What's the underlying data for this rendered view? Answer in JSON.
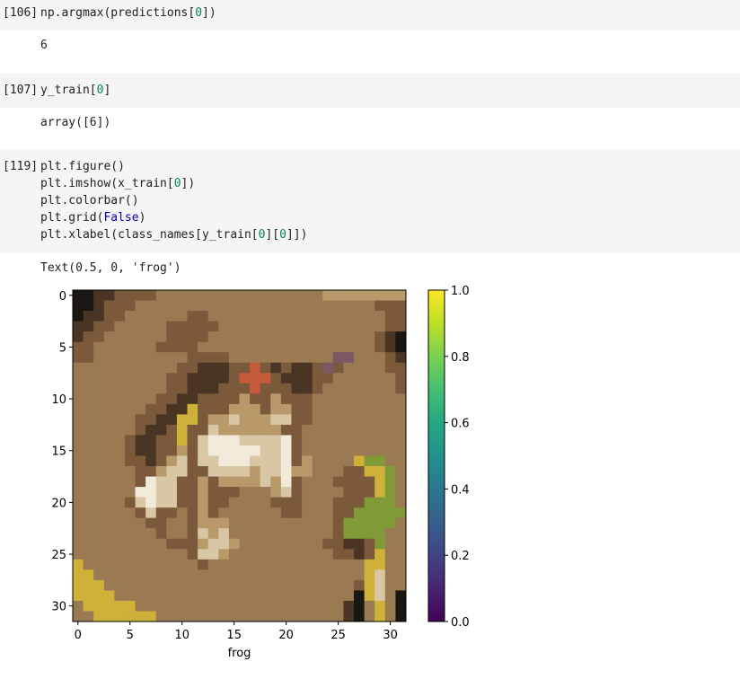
{
  "cells": [
    {
      "prompt": "[106]",
      "code": [
        {
          "parts": [
            {
              "t": "np.argmax(predictions["
            },
            {
              "t": "0",
              "c": "num"
            },
            {
              "t": "])"
            }
          ]
        }
      ],
      "output": "6"
    },
    {
      "prompt": "[107]",
      "code": [
        {
          "parts": [
            {
              "t": "y_train["
            },
            {
              "t": "0",
              "c": "num"
            },
            {
              "t": "]"
            }
          ]
        }
      ],
      "output": "array([6])"
    },
    {
      "prompt": "[119]",
      "code": [
        {
          "parts": [
            {
              "t": "plt.figure()"
            }
          ]
        },
        {
          "parts": [
            {
              "t": "plt.imshow(x_train["
            },
            {
              "t": "0",
              "c": "num"
            },
            {
              "t": "])"
            }
          ]
        },
        {
          "parts": [
            {
              "t": "plt.colorbar()"
            }
          ]
        },
        {
          "parts": [
            {
              "t": "plt.grid("
            },
            {
              "t": "False",
              "c": "kw"
            },
            {
              "t": ")"
            }
          ]
        },
        {
          "parts": [
            {
              "t": "plt.xlabel(class_names[y_train["
            },
            {
              "t": "0",
              "c": "num"
            },
            {
              "t": "]["
            },
            {
              "t": "0",
              "c": "num"
            },
            {
              "t": "]])"
            }
          ]
        }
      ],
      "output": "Text(0.5, 0, 'frog')"
    }
  ],
  "chart_data": {
    "type": "heatmap",
    "xlabel": "frog",
    "ylabel": "",
    "xlim": [
      -0.5,
      31.5
    ],
    "ylim": [
      31.5,
      -0.5
    ],
    "x_ticks": [
      0,
      5,
      10,
      15,
      20,
      25,
      30
    ],
    "y_ticks": [
      0,
      5,
      10,
      15,
      20,
      25,
      30
    ],
    "grid": false,
    "colorbar": {
      "colormap": "viridis",
      "range": [
        0.0,
        1.0
      ],
      "ticks": [
        "0.0",
        "0.2",
        "0.4",
        "0.6",
        "0.8",
        "1.0"
      ]
    },
    "palette": {
      "B": "#1a1611",
      "D": "#4a3524",
      "M": "#7a5a3a",
      "L": "#9a7a52",
      "T": "#b8996a",
      "P": "#d9c6a5",
      "W": "#f2ead8",
      "Y": "#cfb038",
      "G": "#7f9a37",
      "R": "#c45a3a",
      "V": "#7a5866"
    },
    "pixels": [
      "BBDDMMMMLLLLLLLLLLLLLLLLTTTTTTTT",
      "BBDMMMLLLLLLLLLLLLLLLLLLLLLLLMMM",
      "BDDMMLLLLLLMMLLLLLLLLLLLLLLLLLMM",
      "DDMMLLLLLMMMMMLLLLLLLLLLLLLLLLMM",
      "DMMLLLLLLMMMMLLLLLLLLLLLLLLLLMDB",
      "MMLLLLLLMMMMLLLLLLLLLLLLLLLLLMDB",
      "MMLLLLLLLLLMMMMLLLLLLLLLLVVLLLMD",
      "LLLLLLLLLLMMDDDMMRMDMDDMVMLLLLMM",
      "LLLLLLLLLMMDDDDMRRRMDDDMMLLLLLLM",
      "LLLLLLLLLMMDDDMMMRMMMDDMLLLLLLLM",
      "LLLLLLLLMMDDMMMMTMMTMMMLLLLLLLLL",
      "LLLLLLLMMDDYMMMTTTMTTMMLLLLLLLLL",
      "LLLLLLMMDDYYMTTPTTTPPMMLLLLLLLLL",
      "LLLLLLMDDMYMMPTTTTTTMMLLLLLLLLLL",
      "LLLLLMDDMMYMPWWWPPPPWMLLLLLLLLLL",
      "LLLLLMDDMMTMPWWWWWPPWMLLLLLLLLLL",
      "LLLLLMMDMTPMPPWWWPPPWMTLLLLYGGLL",
      "LLLLLLMMTPPMMPPPPTPPWTTLLLMMYYGL",
      "LLLLLLMWPPMMTMTTTTPTWMLLLMMMMYGL",
      "LLLLLLWWPPMMTMMMLLLTPMLLLLMMMYGL",
      "LLLLLMPWPPMMTMMLLLLMMMLLLMMMGGGL",
      "LLLLLLMPMMLMTMLLLLLLMMLLLMMGGGGG",
      "LLLLLLLMMLLMTTTLLLLLLLLLLMGGGGGL",
      "LLLLLLLLMLLMPTPLLLLLLLLLLMGGGGLL",
      "LLLLLLLLLMMMTPPTLLLLLLLLMMDDMGLL",
      "LLLLLLLLLLLMPPTLLLLLLLLLLMMDMYLL",
      "YLLLLLLLLLLLMLLLLLLLLLLLLLLLYYLL",
      "YYLLLLLLLLLLLLLLLLLLLLLLLLLLYPLL",
      "YYYLLLLLLLLLLLLLLLLLLLLLLLLMYPLL",
      "YYYYLLLLLLLLLLLLLLLLLLLLLLLBYPLB",
      "LYYYYYLLLLLLLLLLLLLLLLLLLLDBLYLB",
      "LLYYYYYYLLLLLLLLLLLLLLLLLLDBLYLB"
    ]
  }
}
